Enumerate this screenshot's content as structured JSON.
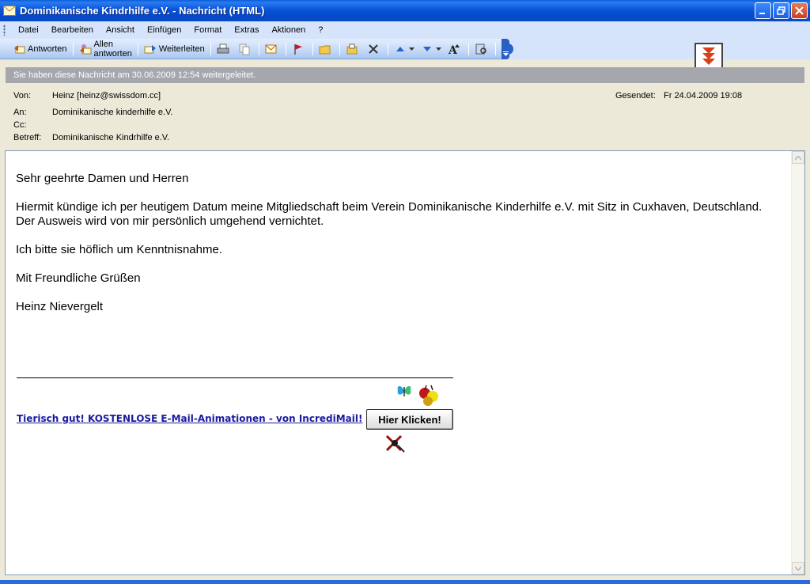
{
  "window": {
    "title": "Dominikanische Kindrhilfe e.V. - Nachricht (HTML)"
  },
  "menu": {
    "items": [
      "Datei",
      "Bearbeiten",
      "Ansicht",
      "Einfügen",
      "Format",
      "Extras",
      "Aktionen",
      "?"
    ]
  },
  "toolbar": {
    "reply_label": "Antworten",
    "reply_all_label": "Allen antworten",
    "forward_label": "Weiterleiten"
  },
  "infobar": {
    "text": "Sie haben diese Nachricht am 30.06.2009 12:54 weitergeleitet."
  },
  "header": {
    "from_label": "Von:",
    "from_value": "Heinz [heinz@swissdom.cc]",
    "to_label": "An:",
    "to_value": "Dominikanische kinderhilfe e.V.",
    "cc_label": "Cc:",
    "cc_value": "",
    "subject_label": "Betreff:",
    "subject_value": "Dominikanische Kindrhilfe e.V.",
    "sent_label": "Gesendet:",
    "sent_value": "Fr 24.04.2009 19:08"
  },
  "message": {
    "greeting": "Sehr geehrte Damen und Herren",
    "paragraph1_line1": "Hiermit kündige ich per heutigem Datum meine Mitgliedschaft beim Verein Dominikanische Kinderhilfe e.V. mit Sitz in Cuxhaven, Deutschland.",
    "paragraph1_line2": "Der Ausweis wird von mir persönlich umgehend vernichtet.",
    "paragraph2": "Ich bitte sie höflich um Kenntnisnahme.",
    "closing": "Mit Freundliche Grüßen",
    "signature": "Heinz Nievergelt"
  },
  "ad": {
    "link_text": "Tierisch gut! KOSTENLOSE E-Mail-Animationen - von IncrediMail!",
    "button_label": "Hier Klicken!"
  },
  "colors": {
    "titlebar": "#0854d9",
    "menubar": "#d6e4fb",
    "infobar": "#a5a7ad",
    "link": "#1a1aa0"
  }
}
